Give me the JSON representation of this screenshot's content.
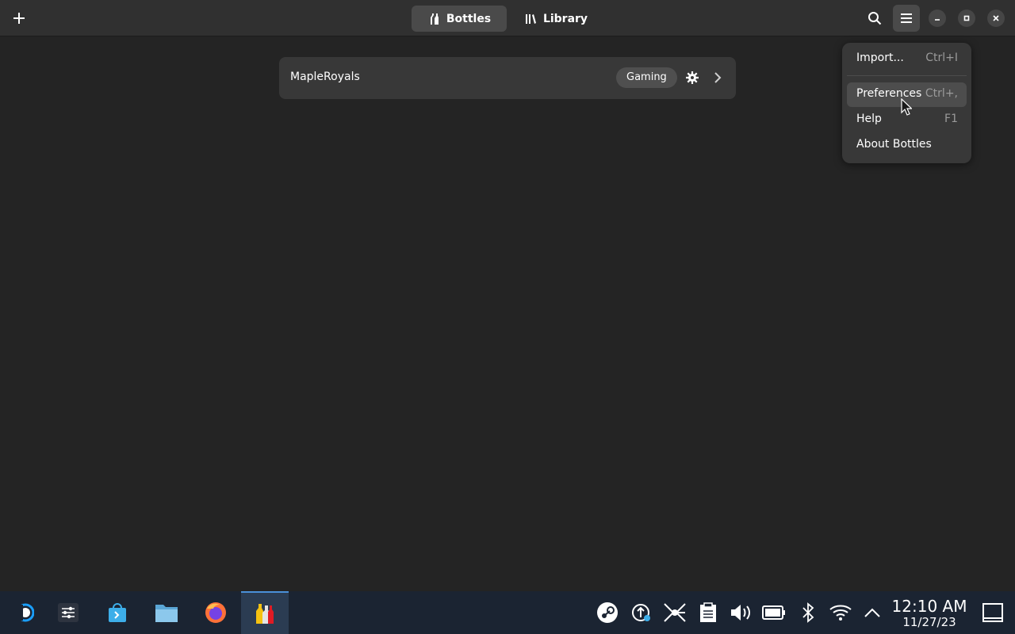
{
  "headerbar": {
    "tabs": [
      {
        "label": "Bottles",
        "active": true,
        "icon": "bottles-icon"
      },
      {
        "label": "Library",
        "active": false,
        "icon": "library-icon"
      }
    ]
  },
  "bottles": [
    {
      "name": "MapleRoyals",
      "tag": "Gaming"
    }
  ],
  "menu": {
    "items": [
      {
        "label": "Import...",
        "accel": "Ctrl+I"
      },
      {
        "label": "Preferences",
        "accel": "Ctrl+,",
        "hover": true
      },
      {
        "label": "Help",
        "accel": "F1"
      },
      {
        "label": "About Bottles",
        "accel": ""
      }
    ]
  },
  "taskbar": {
    "apps": [
      "steam-deck-icon",
      "settings-icon",
      "discover-store-icon",
      "file-manager-icon",
      "firefox-icon",
      "bottles-app-icon"
    ],
    "tray": [
      "steam-icon",
      "update-icon",
      "network-hub-icon",
      "clipboard-icon",
      "volume-icon",
      "battery-icon",
      "bluetooth-icon",
      "wifi-icon",
      "expand-tray-icon"
    ],
    "time": "12:10 AM",
    "date": "11/27/23"
  },
  "colors": {
    "accent": "#4a90d9",
    "window_bg": "#242424",
    "headerbar_bg": "#303030",
    "taskbar_bg": "#1b2432"
  }
}
